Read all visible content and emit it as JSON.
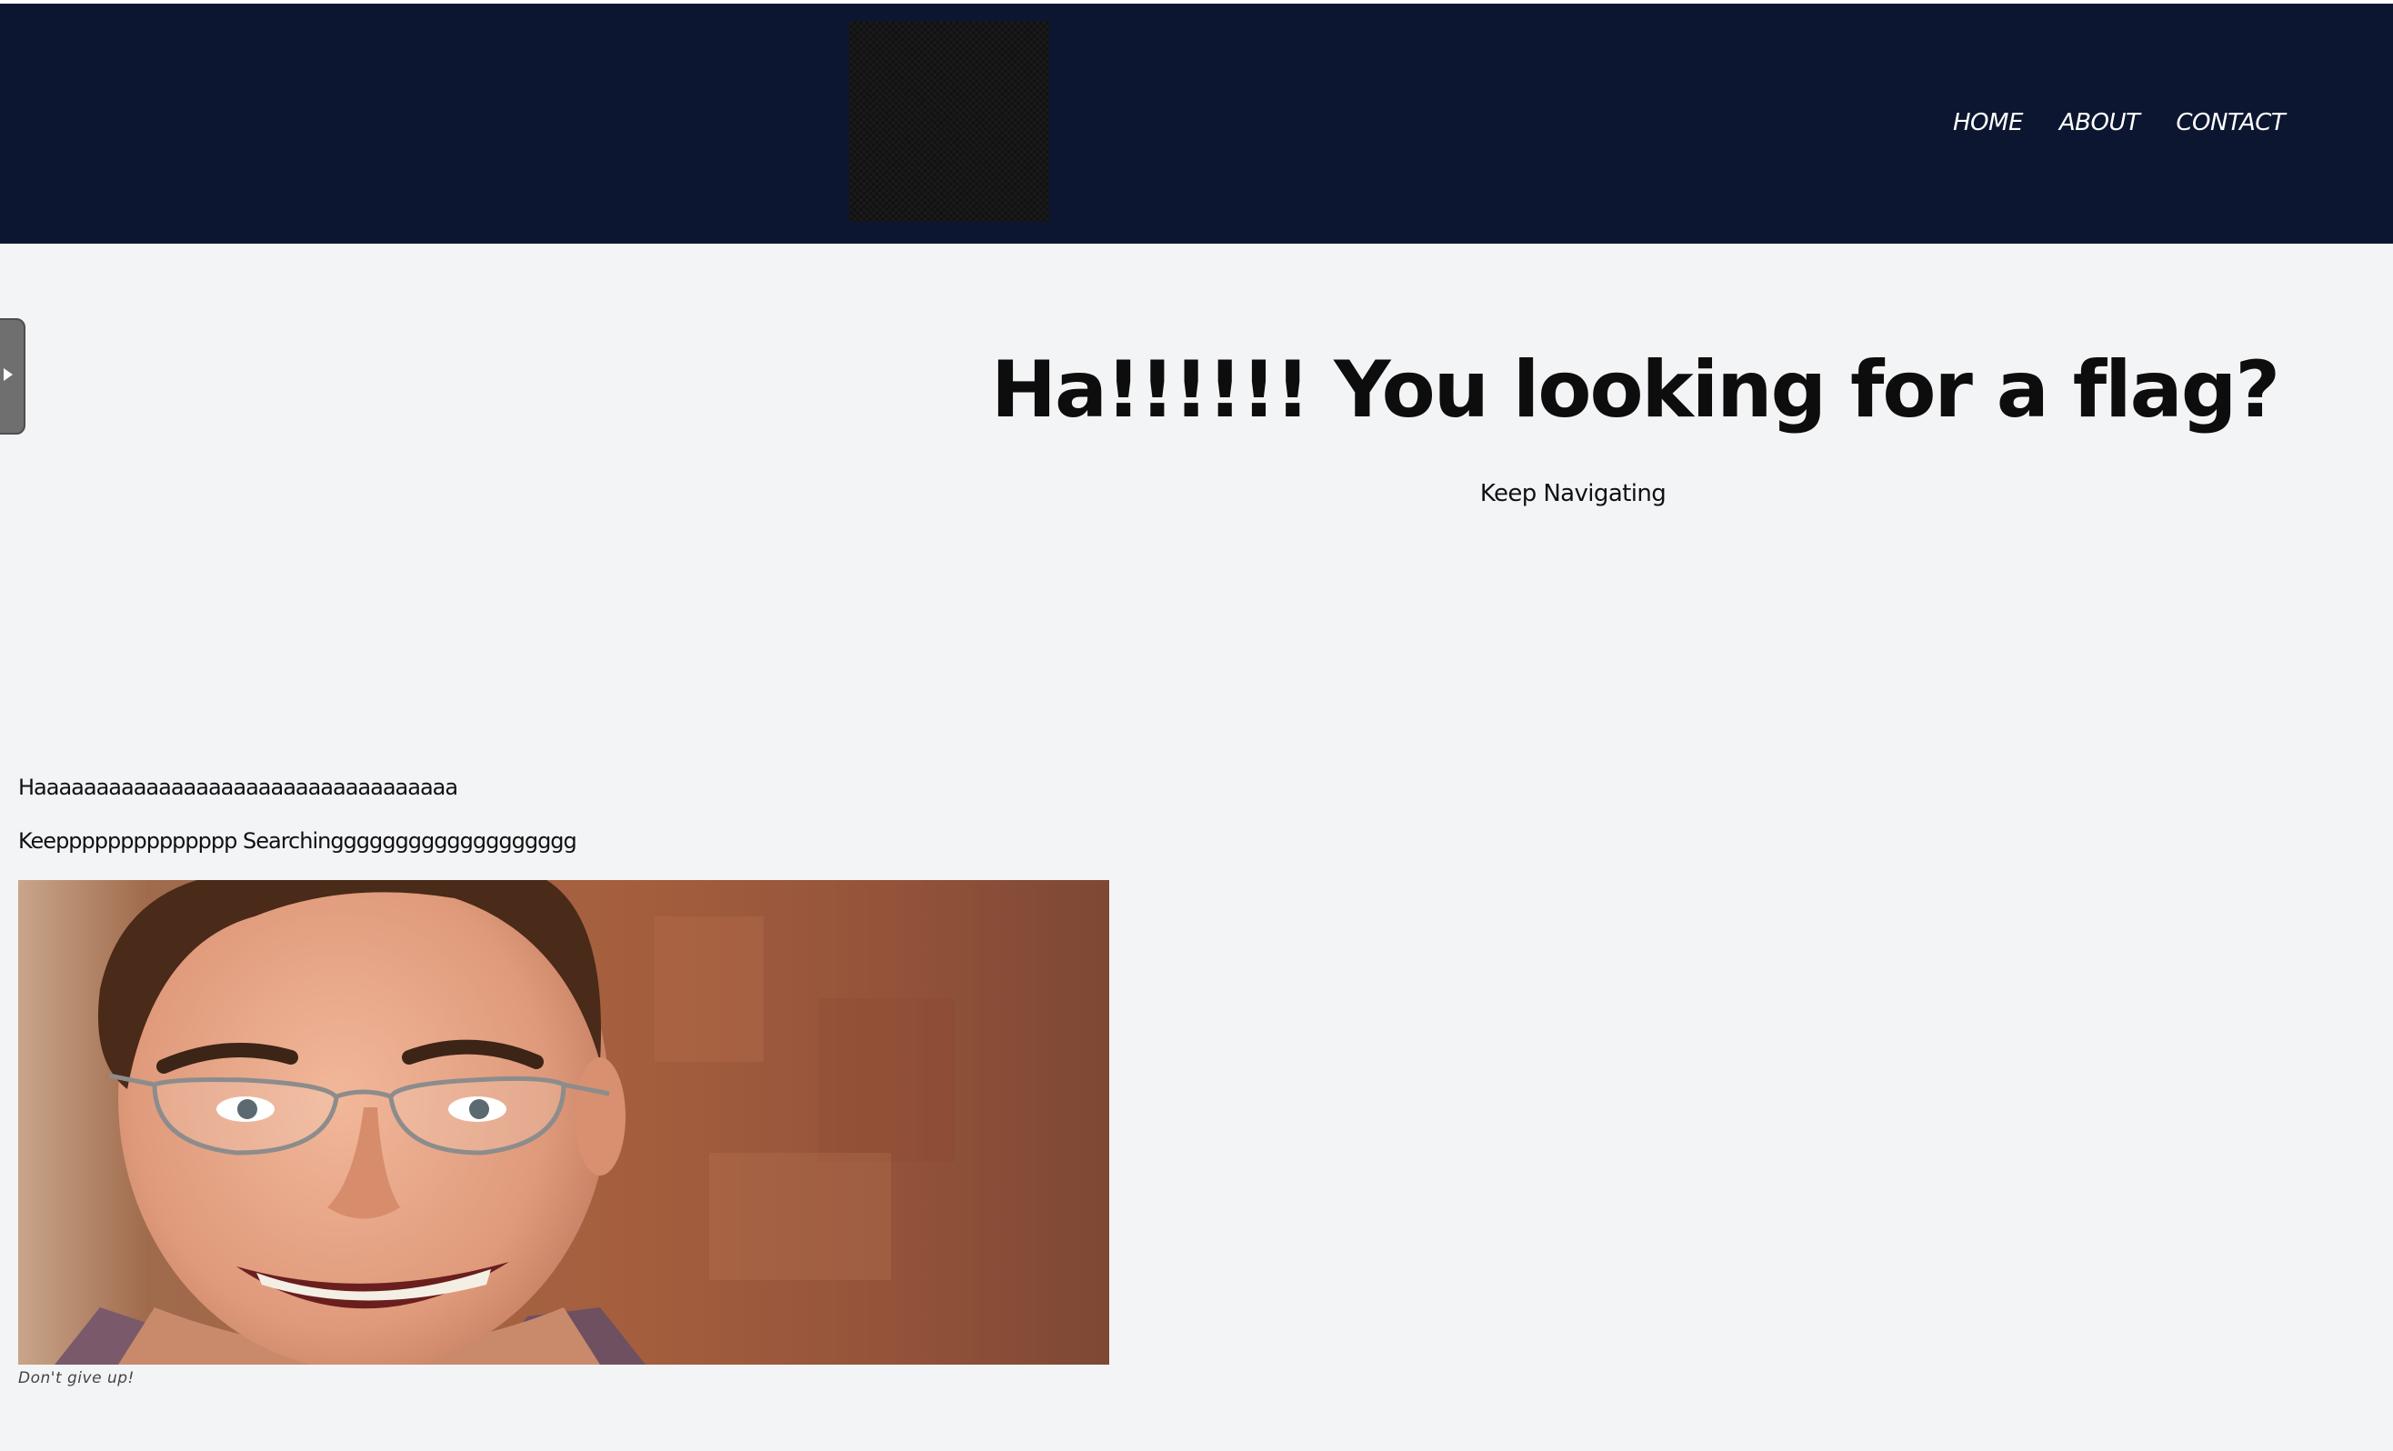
{
  "header": {
    "logo_name": "site-logo",
    "nav": [
      {
        "label": "HOME"
      },
      {
        "label": "ABOUT"
      },
      {
        "label": "CONTACT"
      }
    ]
  },
  "sidebar_toggle": {
    "icon": "play-arrow-icon"
  },
  "hero": {
    "title": "Ha!!!!!! You looking for a flag?",
    "subtitle": "Keep Navigating"
  },
  "content": {
    "paragraph1": "Haaaaaaaaaaaaaaaaaaaaaaaaaaaaaaaaaa",
    "paragraph2": "Keepppppppppppppp Searchinggggggggggggggggggg",
    "image_alt": "Smiling man with glasses",
    "caption": "Don't give up!"
  },
  "colors": {
    "header_bg": "#0c1631",
    "page_bg": "#f3f4f6",
    "text": "#111111"
  }
}
